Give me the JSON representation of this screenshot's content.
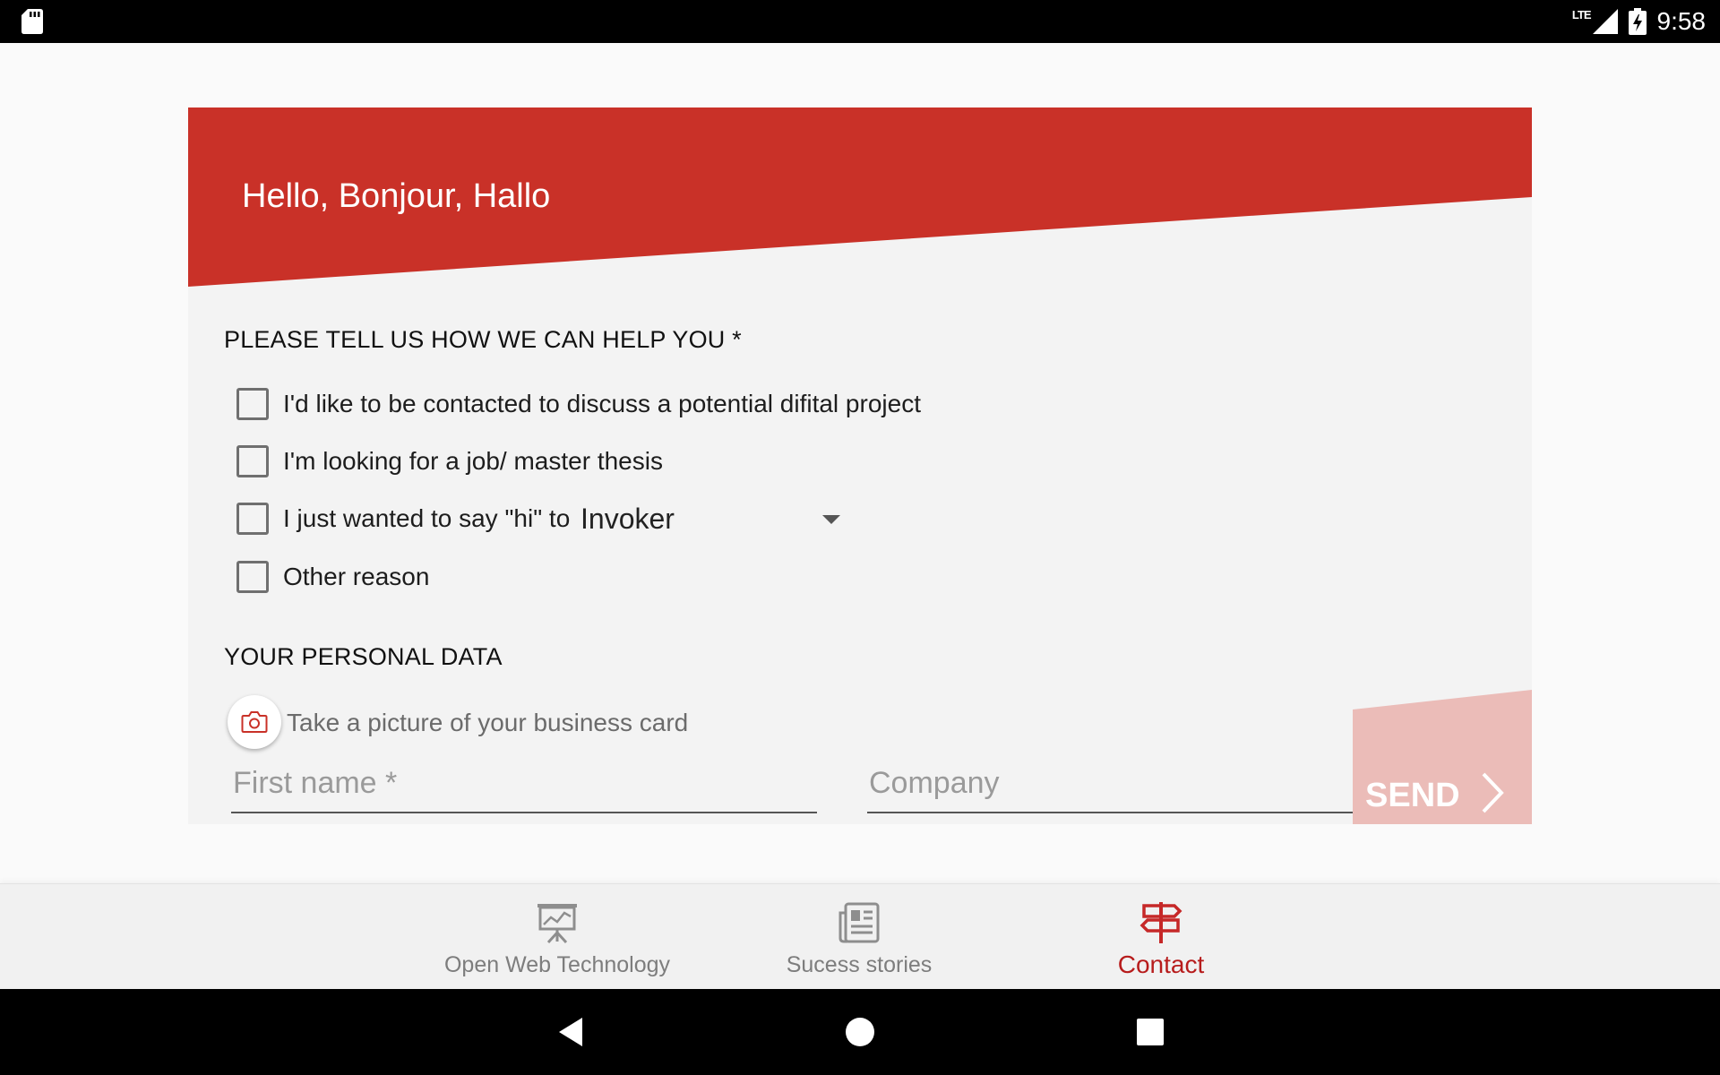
{
  "status_bar": {
    "network": "LTE",
    "time": "9:58"
  },
  "form": {
    "greeting": "Hello, Bonjour, Hallo",
    "help_title": "PLEASE TELL US HOW WE CAN HELP YOU *",
    "options": [
      {
        "label": "I'd like to be contacted to discuss a potential difital project",
        "checked": false
      },
      {
        "label": "I'm looking for a job/ master thesis",
        "checked": false
      },
      {
        "label": "I just wanted to say \"hi\" to",
        "checked": false
      },
      {
        "label": "Other reason",
        "checked": false
      }
    ],
    "hi_select": {
      "value": "Invoker"
    },
    "personal_title": "YOUR PERSONAL DATA",
    "business_card_label": "Take a picture of your business card",
    "first_name": {
      "value": "",
      "placeholder": "First name *"
    },
    "company": {
      "value": "",
      "placeholder": "Company"
    },
    "send_label": "SEND"
  },
  "bottom_nav": {
    "items": [
      {
        "label": "Open Web Technology",
        "icon": "presentation-chart-icon",
        "active": false
      },
      {
        "label": "Sucess stories",
        "icon": "newspaper-icon",
        "active": false
      },
      {
        "label": "Contact",
        "icon": "signpost-icon",
        "active": true
      }
    ]
  },
  "colors": {
    "brand_red": "#c93128",
    "send_button": "#ebbcb8",
    "active_nav": "#b71c1c",
    "card_background": "#f3f3f3"
  }
}
